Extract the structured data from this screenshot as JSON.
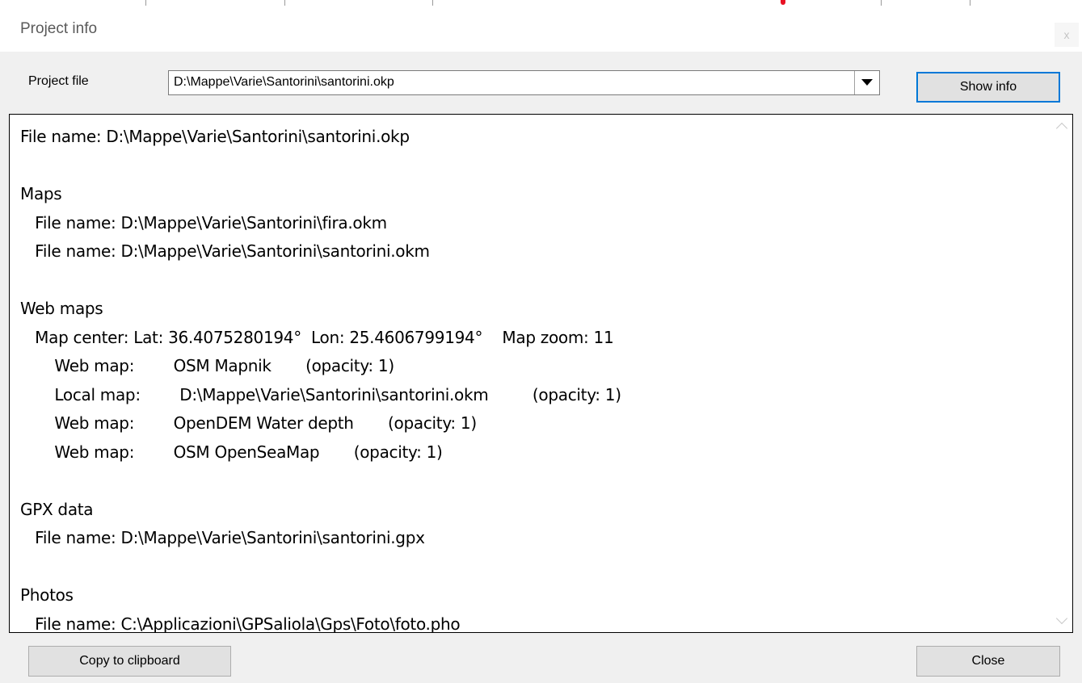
{
  "window": {
    "title": "Project info",
    "close_glyph": "x"
  },
  "project_file": {
    "label": "Project file",
    "value": "D:\\Mappe\\Varie\\Santorini\\santorini.okp"
  },
  "toolbar": {
    "show_info_label": "Show info"
  },
  "info": {
    "lines": [
      "File name: D:\\Mappe\\Varie\\Santorini\\santorini.okp",
      "",
      "Maps",
      "   File name: D:\\Mappe\\Varie\\Santorini\\fira.okm",
      "   File name: D:\\Mappe\\Varie\\Santorini\\santorini.okm",
      "",
      "Web maps",
      "   Map center: Lat: 36.4075280194°  Lon: 25.4606799194°    Map zoom: 11",
      "       Web map:        OSM Mapnik       (opacity: 1)",
      "       Local map:        D:\\Mappe\\Varie\\Santorini\\santorini.okm         (opacity: 1)",
      "       Web map:        OpenDEM Water depth       (opacity: 1)",
      "       Web map:        OSM OpenSeaMap       (opacity: 1)",
      "",
      "GPX data",
      "   File name: D:\\Mappe\\Varie\\Santorini\\santorini.gpx",
      "",
      "Photos",
      "   File name: C:\\Applicazioni\\GPSaliola\\Gps\\Foto\\foto.pho"
    ]
  },
  "footer": {
    "copy_label": "Copy to clipboard",
    "close_label": "Close"
  },
  "icons": {
    "dropdown": "chevron-down-icon",
    "scroll_up": "chevron-up-icon",
    "scroll_down": "chevron-down-icon"
  }
}
